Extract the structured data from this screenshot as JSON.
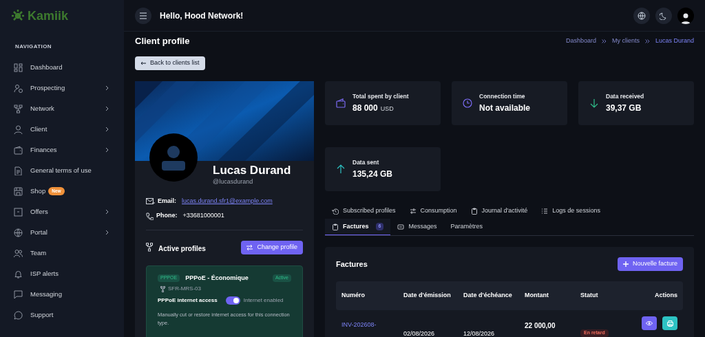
{
  "brand": "Kamiik",
  "sidebar": {
    "section": "NAVIGATION",
    "items": [
      {
        "label": "Dashboard",
        "has_submenu": false
      },
      {
        "label": "Prospecting",
        "has_submenu": true
      },
      {
        "label": "Network",
        "has_submenu": true
      },
      {
        "label": "Client",
        "has_submenu": true
      },
      {
        "label": "Finances",
        "has_submenu": true
      },
      {
        "label": "General terms of use",
        "has_submenu": false
      },
      {
        "label": "Shop",
        "has_submenu": false,
        "badge": "New"
      },
      {
        "label": "Offers",
        "has_submenu": true
      },
      {
        "label": "Portal",
        "has_submenu": true
      },
      {
        "label": "Team",
        "has_submenu": false
      },
      {
        "label": "ISP alerts",
        "has_submenu": false
      },
      {
        "label": "Messaging",
        "has_submenu": false
      },
      {
        "label": "Support",
        "has_submenu": false
      }
    ]
  },
  "header": {
    "greeting": "Hello, Hood Network!"
  },
  "page": {
    "title": "Client profile",
    "breadcrumb": [
      {
        "label": "Dashboard",
        "current": false
      },
      {
        "label": "My clients",
        "current": false
      },
      {
        "label": "Lucas Durand",
        "current": true
      }
    ],
    "back_button": "Back to clients list"
  },
  "profile": {
    "name": "Lucas Durand",
    "handle": "@lucasdurand",
    "email_label": "Email:",
    "email": "lucas.durand.sfr1@example.com",
    "phone_label": "Phone:",
    "phone": "+33681000001",
    "active_profiles": {
      "title": "Active profiles",
      "button": "Change profile",
      "card": {
        "type": "PPPOE",
        "name": "PPPoE - Économique",
        "status": "Active",
        "router": "SFR-MRS-03",
        "access_label": "PPPoE internet access",
        "on": true,
        "toggle_text": "Internet enabled",
        "note": "Manually cut or restore internet access for this connection type."
      }
    }
  },
  "stats": [
    {
      "kind": "wallet",
      "label": "Total spent by client",
      "value": "88 000",
      "unit": "USD"
    },
    {
      "kind": "clock",
      "label": "Connection time",
      "value": "Not available"
    },
    {
      "kind": "down",
      "label": "Data received",
      "value": "39,37 GB"
    },
    {
      "kind": "up",
      "label": "Data sent",
      "value": "135,24 GB"
    }
  ],
  "tabs": [
    {
      "kind": "history",
      "label": "Subscribed profiles",
      "selected": false
    },
    {
      "kind": "sliders",
      "label": "Consumption",
      "selected": false
    },
    {
      "kind": "clipboard",
      "label": "Journal d'activité",
      "selected": false
    },
    {
      "kind": "list",
      "label": "Logs de sessions",
      "selected": false
    },
    {
      "kind": "clipboard",
      "label": "Factures",
      "selected": true,
      "count": "6"
    },
    {
      "kind": "message",
      "label": "Messages",
      "selected": false
    },
    {
      "kind": "none",
      "label": "Paramètres",
      "selected": false
    }
  ],
  "invoices": {
    "title": "Factures",
    "new_button": "Nouvelle facture",
    "columns": [
      "Numéro",
      "Date d'émission",
      "Date d'échéance",
      "Montant",
      "Statut",
      "Actions"
    ],
    "rows": [
      {
        "number": "INV-202608-",
        "issue_date": "02/08/2026",
        "due_date": "12/08/2026",
        "amount": "22 000,00",
        "status": "En retard"
      }
    ]
  }
}
